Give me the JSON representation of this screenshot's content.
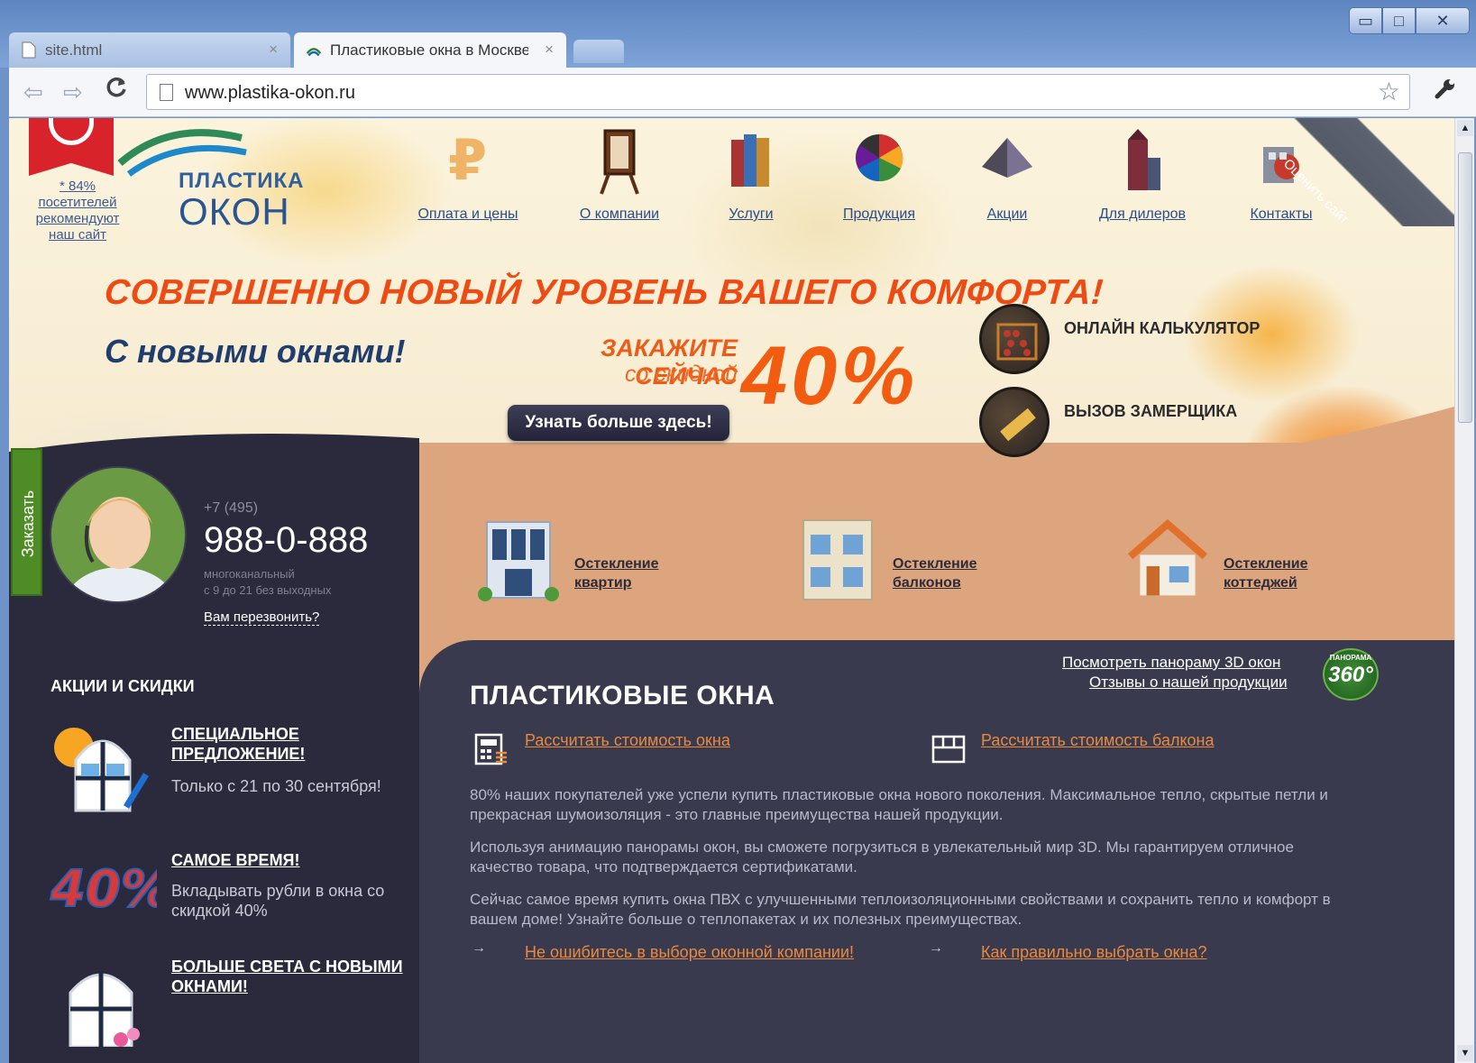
{
  "browser": {
    "tabs": [
      {
        "title": "site.html",
        "close": "×"
      },
      {
        "title": "Пластиковые окна в Москве",
        "close": "×"
      }
    ],
    "window_controls": {
      "minimize": "▭",
      "maximize": "□",
      "close": "✕"
    },
    "url": "www.plastika-okon.ru",
    "nav": {
      "back": "⇦",
      "forward": "⇨",
      "reload": "C"
    }
  },
  "site": {
    "recommend": "* 84% посетителей рекомендуют наш сайт",
    "logo": {
      "top": "ПЛАСТИКА",
      "bottom": "ОКОН"
    },
    "rate_site": "Оценить сайт",
    "nav": [
      {
        "label": "Оплата и цены",
        "icon": "ruble-icon"
      },
      {
        "label": "О компании",
        "icon": "easel-icon"
      },
      {
        "label": "Услуги",
        "icon": "books-icon"
      },
      {
        "label": "Продукция",
        "icon": "color-wheel-icon"
      },
      {
        "label": "Акции",
        "icon": "pyramid-icon"
      },
      {
        "label": "Для дилеров",
        "icon": "building-icon"
      },
      {
        "label": "Контакты",
        "icon": "globe-building-icon"
      }
    ],
    "hero": {
      "headline": "СОВЕРШЕННО НОВЫЙ УРОВЕНЬ ВАШЕГО КОМФОРТА!",
      "sub": "С новыми окнами!",
      "order_now": "ЗАКАЖИТЕ СЕЙЧАС",
      "discount_word": "со скидкой",
      "discount_value": "40%",
      "more_button": "Узнать больше здесь!",
      "calculator": "ОНЛАЙН КАЛЬКУЛЯТОР",
      "measurer": "ВЫЗОВ ЗАМЕРЩИКА"
    },
    "contact": {
      "order_tab": "Заказать",
      "phone_prefix": "+7 (495)",
      "phone": "988-0-888",
      "note_1": "многоканальный",
      "note_2": "с 9 до 21 без выходных",
      "callback": "Вам перезвонить?"
    },
    "promos": {
      "heading": "АКЦИИ И СКИДКИ",
      "items": [
        {
          "title": "СПЕЦИАЛЬНОЕ ПРЕДЛОЖЕНИЕ!",
          "desc": "Только с 21 по 30 сентября!"
        },
        {
          "title": "САМОЕ ВРЕМЯ!",
          "desc": "Вкладывать рубли в окна со скидкой 40%",
          "badge": "40%"
        },
        {
          "title": "БОЛЬШЕ СВЕТА С НОВЫМИ ОКНАМИ!",
          "desc": ""
        }
      ]
    },
    "products": [
      {
        "label": "Остекление квартир"
      },
      {
        "label": "Остекление балконов"
      },
      {
        "label": "Остекление коттеджей"
      }
    ],
    "main": {
      "panorama_link": "Посмотреть панораму 3D окон",
      "reviews_link": "Отзывы о нашей продукции",
      "pano_badge_top": "ПАНОРАМА",
      "pano_badge_num": "360°",
      "title": "ПЛАСТИКОВЫЕ ОКНА",
      "calc_window": "Рассчитать стоимость окна",
      "calc_balcony": "Рассчитать стоимость балкона",
      "para_1": "80% наших покупателей уже успели купить пластиковые окна нового поколения. Максимальное тепло, скрытые петли и прекрасная шумоизоляция - это главные преимущества нашей продукции.",
      "para_2": "Используя анимацию панорамы окон, вы сможете погрузиться в увлекательный мир 3D. Мы гарантируем отличное качество товара, что подтверждается сертификатами.",
      "para_3": "Сейчас самое время купить окна ПВХ с улучшенными теплоизоляционными свойствами и сохранить тепло и комфорт в вашем доме! Узнайте больше о теплопакетах и их полезных преимуществах.",
      "bottom_link_1": "Не ошибитесь в выборе оконной компании!",
      "bottom_link_2": "Как правильно выбрать окна?",
      "arrow": "→"
    }
  },
  "colors": {
    "accent_orange": "#ee4a14",
    "dark_panel": "#2a2a3c",
    "link_orange": "#e8893e",
    "nav_blue": "#2a4c8c"
  }
}
